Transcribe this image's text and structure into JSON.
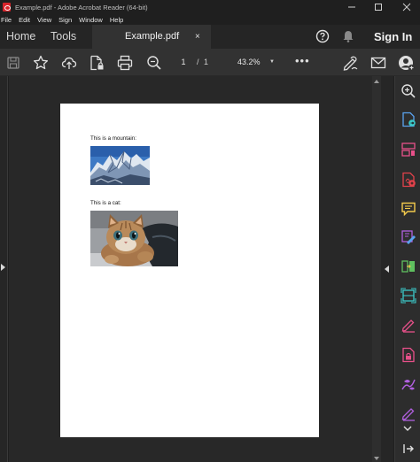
{
  "window": {
    "title": "Example.pdf - Adobe Acrobat Reader (64-bit)",
    "controls": [
      "minimize",
      "maximize",
      "close"
    ]
  },
  "menu": {
    "items": [
      "File",
      "Edit",
      "View",
      "Sign",
      "Window",
      "Help"
    ]
  },
  "tabs": {
    "home": "Home",
    "tools": "Tools",
    "document": "Example.pdf",
    "close_glyph": "×",
    "sign_in": "Sign In"
  },
  "toolbar": {
    "page_current": "1",
    "page_sep": "/",
    "page_total": "1",
    "zoom": "43.2%",
    "more_glyph": "•••"
  },
  "document": {
    "caption_mountain": "This is a mountain:",
    "caption_cat": "This is a cat:"
  },
  "colors": {
    "accent_blue": "#5aa3f0",
    "teal": "#3bc8c8",
    "pink": "#e8508a",
    "red": "#e2424b",
    "yellow": "#f2c94c",
    "green": "#5fbf5f",
    "purple": "#b160e0"
  },
  "icons": {
    "rail": [
      "zoom-search-icon",
      "export-pdf-icon",
      "organize-pages-icon",
      "create-pdf-icon",
      "comment-icon",
      "edit-pdf-icon",
      "combine-files-icon",
      "scan-ocr-icon",
      "fill-sign-icon",
      "protect-icon",
      "request-signature-icon",
      "more-tools-icon"
    ]
  }
}
